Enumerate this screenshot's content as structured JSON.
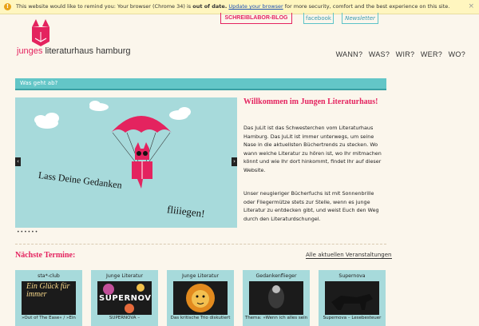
{
  "browser_warning": {
    "icon": "warning-icon",
    "text_before": "This website would like to remind you: Your browser (Chrome 34) is",
    "text_bold": "out of date.",
    "link": "Update your browser",
    "text_after": "for more security, comfort and the best experience on this site.",
    "close": "×"
  },
  "top_links": {
    "blog": "SCHREIBLABOR-BLOG",
    "facebook": "facebook",
    "newsletter": "Newsletter"
  },
  "logo": {
    "prefix": "junges",
    "name": "literaturhaus hamburg"
  },
  "nav": [
    "WANN?",
    "WAS?",
    "WIR?",
    "WER?",
    "WO?"
  ],
  "subbar": {
    "label": "Was geht ab?"
  },
  "slider": {
    "caption_line1": "Lass Deine Gedanken",
    "caption_line2": "fliiiegen!",
    "prev": "‹",
    "next": "›",
    "dots": "••••••"
  },
  "welcome": {
    "title": "Willkommen im Jungen Literaturhaus!",
    "p1": "Das JuLit ist das Schwesterchen vom Literaturhaus Hamburg. Das JuLit ist immer unterwegs, um seine Nase in die aktuellsten Büchertrends zu stecken. Wo wann welche Literatur zu hören ist, wo Ihr mitmachen könnt und wie Ihr dort hinkommt, findet Ihr auf dieser Website.",
    "p2": "Unser neugieriger Bücherfuchs ist mit Sonnenbrille oder Fliegermütze stets zur Stelle, wenn es junge Literatur zu entdecken gibt, und weist Euch den Weg durch den Literaturdschungel."
  },
  "events": {
    "title": "Nächste Termine:",
    "all_link": "Alle aktuellen Veranstaltungen",
    "cards": [
      {
        "category": "sta*-club",
        "image_text": "Ein Glück für immer",
        "subtitle": "»Out of The Ease« / »Ein"
      },
      {
        "category": "Junge Literatur",
        "image_text": "SUPERNOV",
        "subtitle": "SUPERNOVA –"
      },
      {
        "category": "Junge Literatur",
        "image_text": "",
        "subtitle": "Das kritische Trio diskutiert"
      },
      {
        "category": "Gedankenflieger",
        "image_text": "",
        "subtitle": "Thema: »Wenn ich alles sein"
      },
      {
        "category": "Supernova",
        "image_text": "",
        "subtitle": "Supernova – Lesebesteuer"
      }
    ]
  },
  "colors": {
    "accent_pink": "#e4235f",
    "teal": "#63c6c7",
    "light_teal": "#a7dadb",
    "background": "#fbf6ec"
  }
}
